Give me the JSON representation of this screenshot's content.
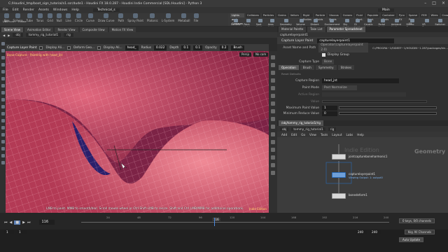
{
  "window": {
    "title": "C:/Houdini_tmp/boot_sign_tutorial/s1.ssr/dude1 - Houdini FX 18.0.287 - Houdini Indie Commercial [SDL:Houdini] - Python 3"
  },
  "menu": [
    "File",
    "Edit",
    "Render",
    "Assets",
    "Windows",
    "Help"
  ],
  "desktop": "Technical_s",
  "main_label": "Main",
  "shelf_left_tools": [
    "Box",
    "Sphere",
    "Tube",
    "Torus",
    "Grid",
    "Null",
    "Line",
    "Circle",
    "Curve",
    "Draw Curve",
    "Path",
    "Spray Paint",
    "Platonic",
    "L-System",
    "Metaball",
    "File"
  ],
  "shelf_left_row2": [
    "UNS+crv",
    "Frame"
  ],
  "shelf_right_tabs": [
    "Lights and Cameras",
    "Collisions",
    "Particles",
    "Grains",
    "Vellum",
    "Rigid Bodies",
    "Particle Fluids",
    "Viscous Fluids",
    "Oceans",
    "Fluid Cont.",
    "Populate Cont.",
    "Container Tools",
    "Pyro FX",
    "Sparse Pyro FX",
    "FEM",
    "Wires",
    "Crowds",
    "Drive Simulation"
  ],
  "shelf_right_tools": [
    "Camera",
    "Point Light",
    "Spot Light",
    "Area Light",
    "Geometry Light",
    "Volume Light",
    "Distant Light",
    "Environment Light",
    "Sky Light",
    "GI Light",
    "Caustic Light",
    "Portal Light",
    "Ambient Light",
    "Stereo Camera",
    "VR Camera",
    "Switcher"
  ],
  "viewer": {
    "tabs": [
      "Scene View",
      "Animation Editor",
      "Render View",
      "Composite View",
      "Motion FX View"
    ],
    "active_tab": "Scene View",
    "path": [
      "obj",
      "tommy_rig_tutorial1",
      "rig"
    ],
    "op_name": "Capture Layer Paint",
    "op_toggles": [
      "Display Ali...",
      "Deform Geo...",
      "Display Ali..."
    ],
    "capture_region_short": "head_",
    "radius_label": "Radius",
    "radius": "0.022",
    "depth_label": "Depth",
    "depth_a": "0.1",
    "depth_b": "0.1",
    "opacity_label": "Opacity",
    "opacity": "0.2",
    "mode": "Brush",
    "hud_text": "Bone Capture - Painting with head_jnt",
    "persp": "Persp",
    "cam": "No cam",
    "status_hint": "LMB to paint. MMB to smooth/blur. Scroll mouse wheel or Ctrl-Shift-LMB to resize. Shift and Ctrl LMB/MMB for additional operations.",
    "indie_tag": "Indie Edition"
  },
  "params": {
    "tabs": [
      "Material Palette",
      "Take List",
      "Parameter Spreadsheet"
    ],
    "breadcrumb": "capturelayerpaint1",
    "node_type": "Capture Layer Paint",
    "node_name": "capturelayerpaint1",
    "asset_label": "Asset Name and Path",
    "asset_value": "Operator(capturelayerpaint 2.0)",
    "asset_path": "C:/PROGRA~1/SIDEEF~1/HOUDIN~1.287/packages/kin...",
    "display_group": "Display Group",
    "capture_type_label": "Capture Type",
    "capture_type": "Bone",
    "subtabs": [
      "Operation",
      "Brush",
      "Symmetry",
      "Strokes"
    ],
    "active_subtab": "Operation",
    "defaults_label": "Reset Defaults",
    "capture_region_label": "Capture Region",
    "capture_region": "head_jnt",
    "paint_mode_label": "Paint Mode",
    "paint_mode": "Post Normalize",
    "active_region_label": "Active Region",
    "value_label": "Value",
    "max_paint_label": "Maximum Paint Value",
    "max_paint": "1",
    "min_reduce_label": "Minimum Reduce Value",
    "min_reduce": "0"
  },
  "network": {
    "tabs": [
      "/obj/tommy_rig_tutorial1/rig"
    ],
    "path": [
      "obj",
      "tommy_rig_tutorial1",
      "rig"
    ],
    "menu": [
      "Add",
      "Edit",
      "Go",
      "View",
      "Tools",
      "Layout",
      "Labs",
      "Help"
    ],
    "context": "Geometry",
    "indie_watermark": "Indie Edition",
    "nodes": [
      {
        "name": "jointcaptureboneharmonic1",
        "sub": ""
      },
      {
        "name": "capturelayerpaint1",
        "sub": "Viewing Output: 1: output0"
      },
      {
        "name": "bonedeform1",
        "sub": ""
      }
    ]
  },
  "timeline": {
    "frame": "116",
    "start": "1",
    "end": "240",
    "end2": "240",
    "marker": "116",
    "ticks": [
      "24",
      "48",
      "72",
      "96",
      "120",
      "144",
      "168",
      "192",
      "216",
      "240"
    ],
    "keys_label": "0 keys, 0/0 channels",
    "key_all": "Key All Channels",
    "auto_update": "Auto Update"
  },
  "colors": {
    "viewport_mesh": "#b83a52",
    "viewport_mesh_light": "#e86a7a",
    "wire": "#f3c7cf",
    "accent_yellow": "#ffd36b",
    "node_hilite": "#2b6bb8"
  }
}
